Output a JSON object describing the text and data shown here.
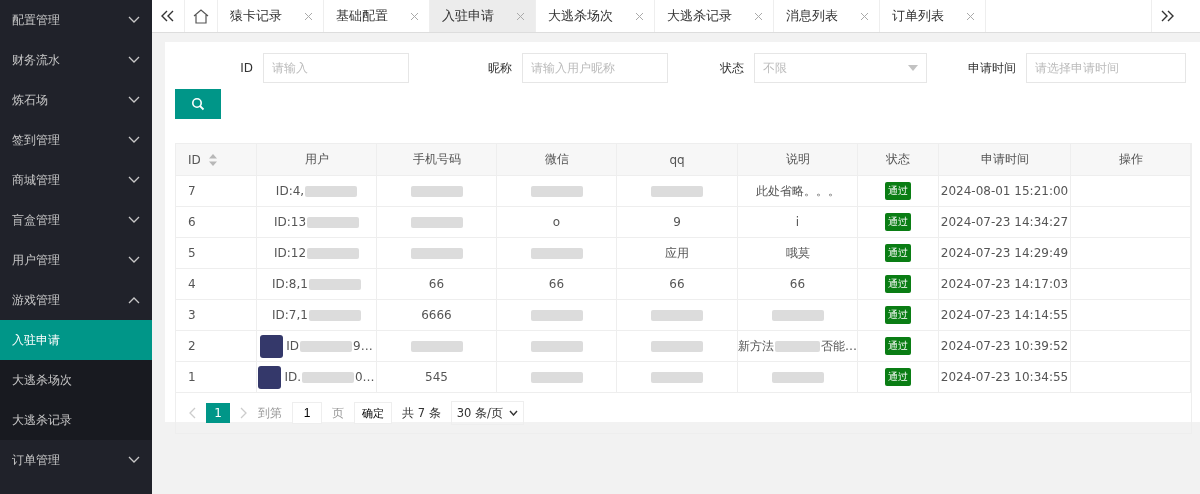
{
  "sidebar": {
    "items": [
      {
        "label": "配置管理",
        "expanded": false
      },
      {
        "label": "财务流水",
        "expanded": false
      },
      {
        "label": "炼石场",
        "expanded": false
      },
      {
        "label": "签到管理",
        "expanded": false
      },
      {
        "label": "商城管理",
        "expanded": false
      },
      {
        "label": "盲盒管理",
        "expanded": false
      },
      {
        "label": "用户管理",
        "expanded": false
      },
      {
        "label": "游戏管理",
        "expanded": true,
        "children": [
          {
            "label": "入驻申请",
            "selected": true
          },
          {
            "label": "大逃杀场次",
            "selected": false
          },
          {
            "label": "大逃杀记录",
            "selected": false
          }
        ]
      },
      {
        "label": "订单管理",
        "expanded": false
      }
    ]
  },
  "tabs": [
    {
      "label": "猿卡记录",
      "selected": false
    },
    {
      "label": "基础配置",
      "selected": false
    },
    {
      "label": "入驻申请",
      "selected": true
    },
    {
      "label": "大逃杀场次",
      "selected": false
    },
    {
      "label": "大逃杀记录",
      "selected": false
    },
    {
      "label": "消息列表",
      "selected": false
    },
    {
      "label": "订单列表",
      "selected": false
    }
  ],
  "filters": [
    {
      "label": "ID",
      "kind": "input",
      "placeholder": "请输入"
    },
    {
      "label": "昵称",
      "kind": "input",
      "placeholder": "请输入用户昵称"
    },
    {
      "label": "状态",
      "kind": "select",
      "placeholder": "不限"
    },
    {
      "label": "申请时间",
      "kind": "input",
      "placeholder": "请选择申请时间"
    }
  ],
  "table": {
    "columns": [
      "ID",
      "用户",
      "手机号码",
      "微信",
      "qq",
      "说明",
      "状态",
      "申请时间",
      "操作"
    ],
    "rows": [
      {
        "avatar": false,
        "cells": [
          {
            "kind": "text",
            "text": "7",
            "blurred": false
          },
          {
            "kind": "text",
            "text": "ID:4,",
            "blurred": true
          },
          {
            "kind": "text",
            "text": "",
            "blurred": true
          },
          {
            "kind": "text",
            "text": "",
            "blurred": true
          },
          {
            "kind": "text",
            "text": "",
            "blurred": true
          },
          {
            "kind": "text",
            "text": "此处省略。。。",
            "blurred": false
          },
          {
            "kind": "badge",
            "text": "通过",
            "blurred": false
          },
          {
            "kind": "text",
            "text": "2024-08-01 15:21:00",
            "blurred": false
          },
          {
            "kind": "text",
            "text": "",
            "blurred": false
          }
        ]
      },
      {
        "avatar": false,
        "cells": [
          {
            "kind": "text",
            "text": "6",
            "blurred": false
          },
          {
            "kind": "text",
            "text": "ID:13",
            "blurred": true
          },
          {
            "kind": "text",
            "text": "",
            "blurred": true
          },
          {
            "kind": "text",
            "text": "o",
            "blurred": false
          },
          {
            "kind": "text",
            "text": "9",
            "blurred": false
          },
          {
            "kind": "text",
            "text": "i",
            "blurred": false
          },
          {
            "kind": "badge",
            "text": "通过",
            "blurred": false
          },
          {
            "kind": "text",
            "text": "2024-07-23 14:34:27",
            "blurred": false
          },
          {
            "kind": "text",
            "text": "",
            "blurred": false
          }
        ]
      },
      {
        "avatar": false,
        "cells": [
          {
            "kind": "text",
            "text": "5",
            "blurred": false
          },
          {
            "kind": "text",
            "text": "ID:12",
            "blurred": true
          },
          {
            "kind": "text",
            "text": "",
            "blurred": true
          },
          {
            "kind": "text",
            "text": "",
            "blurred": true
          },
          {
            "kind": "text",
            "text": "应用",
            "blurred": false
          },
          {
            "kind": "text",
            "text": "哦莫",
            "blurred": false
          },
          {
            "kind": "badge",
            "text": "通过",
            "blurred": false
          },
          {
            "kind": "text",
            "text": "2024-07-23 14:29:49",
            "blurred": false
          },
          {
            "kind": "text",
            "text": "",
            "blurred": false
          }
        ]
      },
      {
        "avatar": false,
        "cells": [
          {
            "kind": "text",
            "text": "4",
            "blurred": false
          },
          {
            "kind": "text",
            "text": "ID:8,1",
            "blurred": true
          },
          {
            "kind": "text",
            "text": "66",
            "blurred": false
          },
          {
            "kind": "text",
            "text": "66",
            "blurred": false
          },
          {
            "kind": "text",
            "text": "66",
            "blurred": false
          },
          {
            "kind": "text",
            "text": "66",
            "blurred": false
          },
          {
            "kind": "badge",
            "text": "通过",
            "blurred": false
          },
          {
            "kind": "text",
            "text": "2024-07-23 14:17:03",
            "blurred": false
          },
          {
            "kind": "text",
            "text": "",
            "blurred": false
          }
        ]
      },
      {
        "avatar": false,
        "cells": [
          {
            "kind": "text",
            "text": "3",
            "blurred": false
          },
          {
            "kind": "text",
            "text": "ID:7,1",
            "blurred": true
          },
          {
            "kind": "text",
            "text": "6666",
            "blurred": false
          },
          {
            "kind": "text",
            "text": "",
            "blurred": true
          },
          {
            "kind": "text",
            "text": "",
            "blurred": true
          },
          {
            "kind": "text",
            "text": "",
            "blurred": true
          },
          {
            "kind": "badge",
            "text": "通过",
            "blurred": false
          },
          {
            "kind": "text",
            "text": "2024-07-23 14:14:55",
            "blurred": false
          },
          {
            "kind": "text",
            "text": "",
            "blurred": false
          }
        ]
      },
      {
        "avatar": true,
        "cells": [
          {
            "kind": "text",
            "text": "2",
            "blurred": false
          },
          {
            "kind": "text",
            "text": "ID",
            "blurred": true,
            "after": "9…"
          },
          {
            "kind": "text",
            "text": "",
            "blurred": true
          },
          {
            "kind": "text",
            "text": "",
            "blurred": true
          },
          {
            "kind": "text",
            "text": "",
            "blurred": true
          },
          {
            "kind": "text",
            "text": "新方法",
            "blurred": true,
            "after": "否能…"
          },
          {
            "kind": "badge",
            "text": "通过",
            "blurred": false
          },
          {
            "kind": "text",
            "text": "2024-07-23 10:39:52",
            "blurred": false
          },
          {
            "kind": "text",
            "text": "",
            "blurred": false
          }
        ]
      },
      {
        "avatar": true,
        "cells": [
          {
            "kind": "text",
            "text": "1",
            "blurred": false
          },
          {
            "kind": "text",
            "text": "ID.",
            "blurred": true,
            "after": "0…"
          },
          {
            "kind": "text",
            "text": "545",
            "blurred": false
          },
          {
            "kind": "text",
            "text": "",
            "blurred": true
          },
          {
            "kind": "text",
            "text": "",
            "blurred": true
          },
          {
            "kind": "text",
            "text": "",
            "blurred": true
          },
          {
            "kind": "badge",
            "text": "通过",
            "blurred": false
          },
          {
            "kind": "text",
            "text": "2024-07-23 10:34:55",
            "blurred": false
          },
          {
            "kind": "text",
            "text": "",
            "blurred": false
          }
        ]
      }
    ]
  },
  "pagination": {
    "pages": [
      {
        "label": "1",
        "selected": true
      }
    ],
    "goto_label": "到第",
    "goto_value": "1",
    "page_unit": "页",
    "confirm": "确定",
    "total": "共 7 条",
    "page_size": "30 条/页"
  }
}
